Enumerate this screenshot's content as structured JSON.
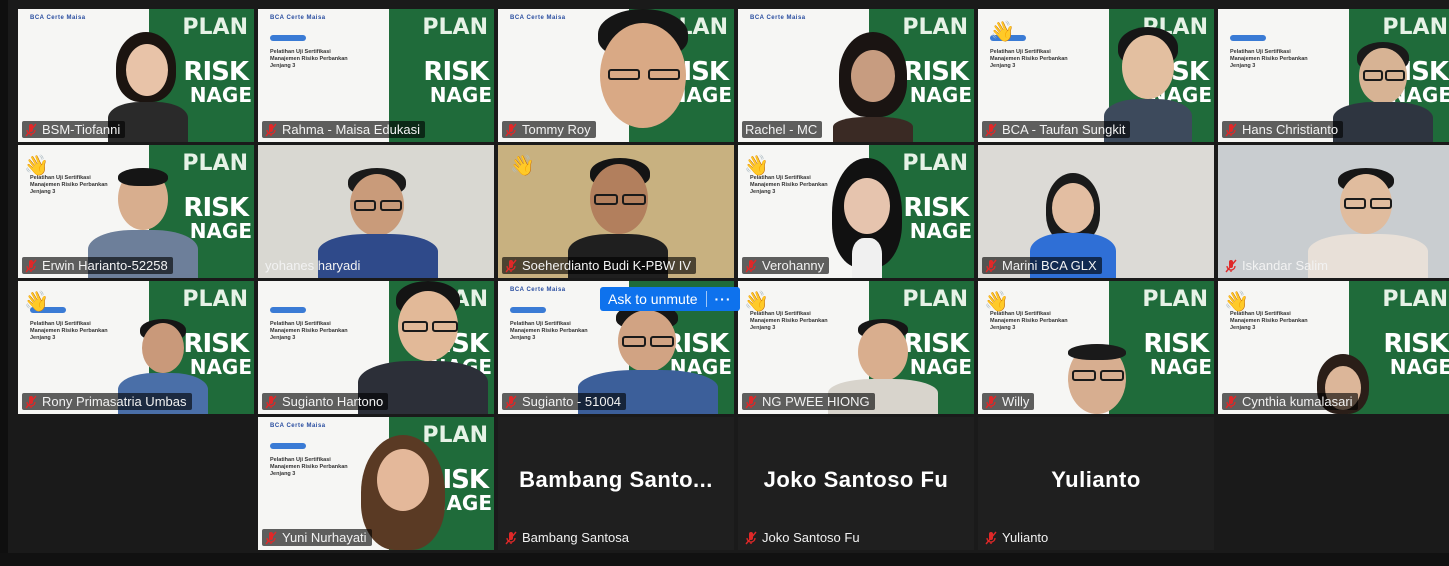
{
  "meeting": {
    "ask_to_unmute": "Ask to unmute",
    "more_label": "···"
  },
  "slide": {
    "logos": "BCA  Certe  Maisa",
    "title": "Pelatihan Uji Sertifikasi Manajemen Risiko Perbankan Jenjang 3",
    "risk": "RISK",
    "manage": "NAGE",
    "plan": "PLAN"
  },
  "participants": [
    {
      "name": "BSM-Tiofanni",
      "muted": true
    },
    {
      "name": "Rahma - Maisa Edukasi",
      "muted": true
    },
    {
      "name": "Tommy Roy",
      "muted": true
    },
    {
      "name": "Rachel - MC",
      "muted": false
    },
    {
      "name": "BCA - Taufan Sungkit",
      "muted": true
    },
    {
      "name": "Hans Christianto",
      "muted": true
    },
    {
      "name": "Erwin Harianto-52258",
      "muted": true
    },
    {
      "name": "yohanes haryadi",
      "muted": false
    },
    {
      "name": "Soeherdianto Budi K-PBW IV",
      "muted": true
    },
    {
      "name": "Verohanny",
      "muted": true
    },
    {
      "name": "Marini BCA GLX",
      "muted": true
    },
    {
      "name": "Iskandar Salim",
      "muted": true
    },
    {
      "name": "Rony Primasatria Umbas",
      "muted": true
    },
    {
      "name": "Sugianto Hartono",
      "muted": true
    },
    {
      "name": "Sugianto - 51004",
      "muted": true
    },
    {
      "name": "NG PWEE HIONG",
      "muted": true
    },
    {
      "name": "Willy",
      "muted": true
    },
    {
      "name": "Cynthia kumalasari",
      "muted": true
    },
    {
      "name": "Yuni Nurhayati",
      "muted": true
    }
  ],
  "no_video": [
    {
      "display": "Bambang  Santo...",
      "name": "Bambang Santosa"
    },
    {
      "display": "Joko Santoso Fu",
      "name": "Joko Santoso Fu"
    },
    {
      "display": "Yulianto",
      "name": "Yulianto"
    }
  ],
  "colors": {
    "active_border": "#3cc46a",
    "unmute_blue": "#0e72ed",
    "muted_icon": "#e02828",
    "slide_green": "#1f6b3a"
  }
}
